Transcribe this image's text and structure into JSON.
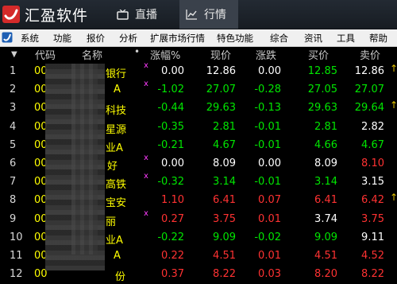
{
  "titlebar": {
    "app_name": "汇盈软件",
    "tabs": [
      {
        "label": "直播",
        "icon": "tv-icon"
      },
      {
        "label": "行情",
        "icon": "chart-trend-icon"
      }
    ]
  },
  "menu": {
    "items": [
      "系统",
      "功能",
      "报价",
      "分析",
      "扩展市场行情",
      "特色功能",
      "综合",
      "资讯",
      "工具",
      "帮助"
    ]
  },
  "table": {
    "headers": {
      "code": "代码",
      "name": "名称",
      "pct": "涨幅%",
      "price": "现价",
      "chg": "涨跌",
      "bid": "买价",
      "ask": "卖价"
    },
    "rows": [
      {
        "idx": "1",
        "code": "00",
        "name": "银行",
        "pct": "0.00",
        "price": "12.86",
        "chg": "0.00",
        "bid": "12.85",
        "ask": "12.86",
        "flag": "x",
        "tick": "↑",
        "status": [
          "flat",
          "flat",
          "flat",
          "down",
          "flat"
        ]
      },
      {
        "idx": "2",
        "code": "00",
        "name": "A",
        "pct": "-1.02",
        "price": "27.07",
        "chg": "-0.28",
        "bid": "27.05",
        "ask": "27.07",
        "flag": "x",
        "tick": "",
        "status": [
          "down",
          "down",
          "down",
          "down",
          "down"
        ]
      },
      {
        "idx": "3",
        "code": "00",
        "name": "科技",
        "pct": "-0.44",
        "price": "29.63",
        "chg": "-0.13",
        "bid": "29.63",
        "ask": "29.64",
        "flag": "",
        "tick": "↑",
        "status": [
          "down",
          "down",
          "down",
          "down",
          "down"
        ]
      },
      {
        "idx": "4",
        "code": "00",
        "name": "星源",
        "pct": "-0.35",
        "price": "2.81",
        "chg": "-0.01",
        "bid": "2.81",
        "ask": "2.82",
        "flag": "",
        "tick": "",
        "status": [
          "down",
          "down",
          "down",
          "down",
          "flat"
        ]
      },
      {
        "idx": "5",
        "code": "00",
        "name": "业A",
        "pct": "-0.21",
        "price": "4.67",
        "chg": "-0.01",
        "bid": "4.66",
        "ask": "4.67",
        "flag": "",
        "tick": "",
        "status": [
          "down",
          "down",
          "down",
          "down",
          "down"
        ]
      },
      {
        "idx": "6",
        "code": "00",
        "name": "好",
        "pct": "0.00",
        "price": "8.09",
        "chg": "0.00",
        "bid": "8.09",
        "ask": "8.10",
        "flag": "x",
        "tick": "",
        "status": [
          "flat",
          "flat",
          "flat",
          "flat",
          "up"
        ]
      },
      {
        "idx": "7",
        "code": "00",
        "name": "高铁",
        "pct": "-0.32",
        "price": "3.14",
        "chg": "-0.01",
        "bid": "3.14",
        "ask": "3.15",
        "flag": "x",
        "tick": "",
        "status": [
          "down",
          "down",
          "down",
          "down",
          "flat"
        ]
      },
      {
        "idx": "8",
        "code": "00",
        "name": "宝安",
        "pct": "1.10",
        "price": "6.41",
        "chg": "0.07",
        "bid": "6.41",
        "ask": "6.42",
        "flag": "",
        "tick": "↑",
        "status": [
          "up",
          "up",
          "up",
          "up",
          "up"
        ]
      },
      {
        "idx": "9",
        "code": "00",
        "name": "丽",
        "pct": "0.27",
        "price": "3.75",
        "chg": "0.01",
        "bid": "3.74",
        "ask": "3.75",
        "flag": "x",
        "tick": "",
        "status": [
          "up",
          "up",
          "up",
          "flat",
          "up"
        ]
      },
      {
        "idx": "10",
        "code": "00",
        "name": "业A",
        "pct": "-0.22",
        "price": "9.09",
        "chg": "-0.02",
        "bid": "9.09",
        "ask": "9.11",
        "flag": "",
        "tick": "",
        "status": [
          "down",
          "down",
          "down",
          "down",
          "flat"
        ]
      },
      {
        "idx": "11",
        "code": "00",
        "name": "A",
        "pct": "0.22",
        "price": "4.51",
        "chg": "0.01",
        "bid": "4.51",
        "ask": "4.52",
        "flag": "",
        "tick": "",
        "status": [
          "up",
          "up",
          "up",
          "up",
          "up"
        ]
      },
      {
        "idx": "12",
        "code": "00",
        "name": "份",
        "pct": "0.37",
        "price": "8.22",
        "chg": "0.03",
        "bid": "8.20",
        "ask": "8.22",
        "flag": "",
        "tick": "",
        "status": [
          "up",
          "up",
          "up",
          "up",
          "up"
        ]
      }
    ]
  },
  "colors": {
    "up": "#ff3232",
    "down": "#00e600",
    "flat": "#ffffff",
    "code": "#ffff00",
    "background": "#000000"
  }
}
